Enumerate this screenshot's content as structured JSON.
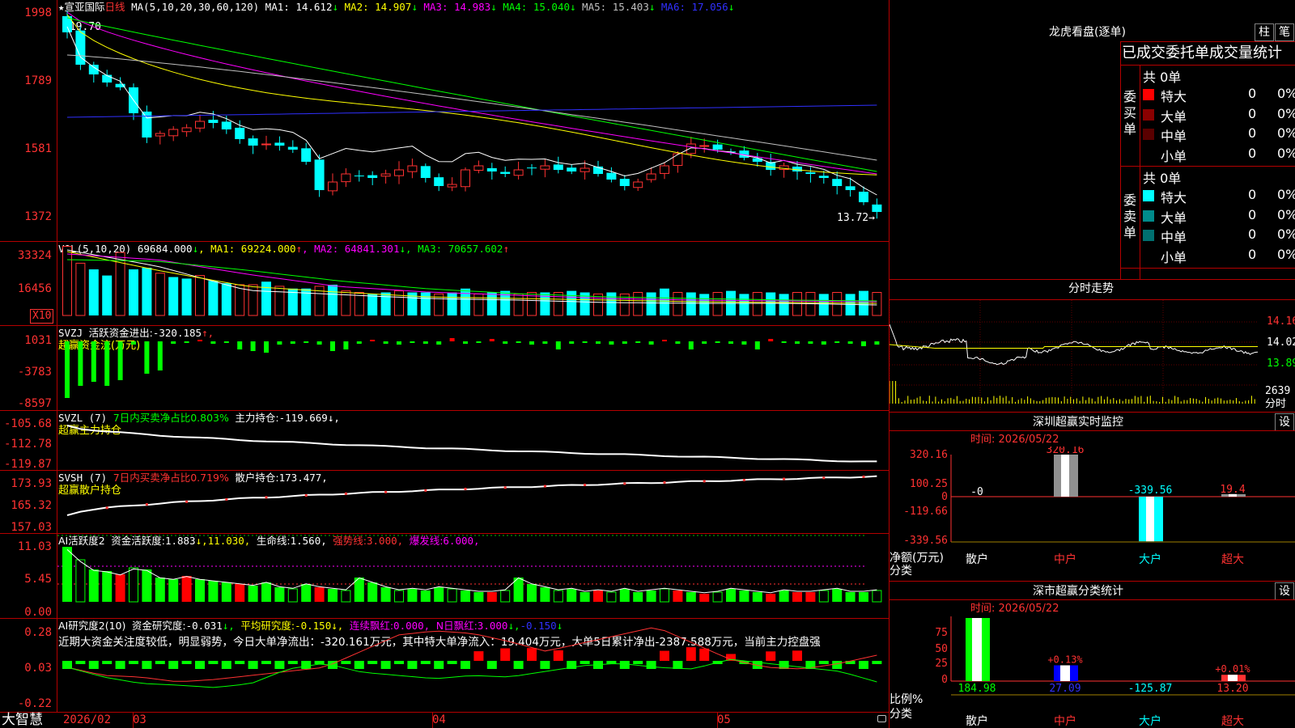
{
  "app": {
    "brand": "大智慧"
  },
  "main_chart": {
    "star": "★",
    "stock_name": "宣亚国际",
    "period": "日线",
    "ma_label": "MA(5,10,20,30,60,120)",
    "ma": [
      {
        "name": "MA1:",
        "value": "14.612",
        "arrow": "↓",
        "color": "#ffffff"
      },
      {
        "name": "MA2:",
        "value": "14.907",
        "arrow": "↓",
        "color": "#ffff00"
      },
      {
        "name": "MA3:",
        "value": "14.983",
        "arrow": "↓",
        "color": "#ff00ff"
      },
      {
        "name": "MA4:",
        "value": "15.040",
        "arrow": "↓",
        "color": "#00ff00"
      },
      {
        "name": "MA5:",
        "value": "15.403",
        "arrow": "↓",
        "color": "#c0c0c0"
      },
      {
        "name": "MA6:",
        "value": "17.056",
        "arrow": "↓",
        "color": "#3030ff"
      }
    ],
    "high_label": "←19.70",
    "low_label": "13.72→",
    "y_ticks": [
      "1998",
      "1789",
      "1581",
      "1372"
    ]
  },
  "vol": {
    "label": "VOL(5,10,20)",
    "value": "69684.000",
    "arrow": "↓",
    "ma": [
      {
        "name": "MA1:",
        "value": "69224.000",
        "arrow": "↑",
        "color": "#ffff00"
      },
      {
        "name": "MA2:",
        "value": "64841.301",
        "arrow": "↓",
        "color": "#ff00ff"
      },
      {
        "name": "MA3:",
        "value": "70657.602",
        "arrow": "↑",
        "color": "#00ff00"
      }
    ],
    "y_ticks": [
      "33324",
      "16456"
    ],
    "unit": "X10"
  },
  "svzj": {
    "label": "SVZJ",
    "desc": "活跃资金进出:",
    "value": "-320.185",
    "arrow": "↑,",
    "sub": "超赢资金流(万元)",
    "y_ticks": [
      "1031",
      "-3783",
      "-8597"
    ]
  },
  "svzl": {
    "label": "SVZL (7)",
    "desc": "7日内买卖净占比0.803%",
    "main_label": "主力持仓:",
    "value": "-119.669",
    "arrow": "↓,",
    "sub": "超赢主力持仓",
    "y_ticks": [
      "-105.68",
      "-112.78",
      "-119.87"
    ]
  },
  "svsh": {
    "label": "SVSH (7)",
    "desc": "7日内买卖净占比0.719%",
    "main_label": "散户持仓:",
    "value": "173.477,",
    "sub": "超赢散户持仓",
    "y_ticks": [
      "173.93",
      "165.32",
      "157.03"
    ]
  },
  "ai_active": {
    "label": "AI活跃度2",
    "desc": "资金活跃度:",
    "value": "1.883",
    "arrow": "↓,",
    "v2": "11.030,",
    "life_label": "生命线:",
    "life_value": "1.560,",
    "strong_label": "强势线:",
    "strong_value": "3.000,",
    "burst_label": "爆发线:",
    "burst_value": "6.000,",
    "y_ticks": [
      "11.03",
      "5.45",
      "0.00"
    ]
  },
  "ai_research": {
    "label": "AI研究度2(10)",
    "desc": "资金研究度:",
    "value": "-0.031",
    "arrow": "↓,",
    "avg_label": "平均研究度:",
    "avg_value": "-0.150",
    "lianxu_label": "连续飘红:",
    "lianxu_value": "0.000,",
    "nday_label": "N日飘红:",
    "nday_value": "3.000",
    "last_value": "-0.150",
    "note": "近期大资金关注度较低，明显弱势，今日大单净流出：-320.161万元，其中特大单净流入：19.404万元，大单5日累计净出-2387.588万元，当前主力控盘强",
    "y_ticks": [
      "0.28",
      "0.03",
      "-0.22"
    ]
  },
  "date_axis": [
    "2026/02",
    "03",
    "04",
    "05"
  ],
  "longhu": {
    "title": "龙虎看盘(逐单)",
    "btn_a": "柱",
    "btn_b": "笔",
    "header": "已成交委托单成交量统计",
    "buy_label": "委买单",
    "sell_label": "委卖单",
    "buy_total": "共 0单",
    "sell_total": "共 0单",
    "buy_rows": [
      {
        "name": "特大",
        "count": "0",
        "pct": "0%",
        "color": "#ff0000"
      },
      {
        "name": "大单",
        "count": "0",
        "pct": "0%",
        "color": "#8b0000"
      },
      {
        "name": "中单",
        "count": "0",
        "pct": "0%",
        "color": "#5a0000"
      },
      {
        "name": "小单",
        "count": "0",
        "pct": "0%",
        "color": "#000000"
      }
    ],
    "sell_rows": [
      {
        "name": "特大",
        "count": "0",
        "pct": "0%",
        "color": "#00ffff"
      },
      {
        "name": "大单",
        "count": "0",
        "pct": "0%",
        "color": "#008b8b"
      },
      {
        "name": "中单",
        "count": "0",
        "pct": "0%",
        "color": "#007070"
      },
      {
        "name": "小单",
        "count": "0",
        "pct": "0%",
        "color": "#000000"
      }
    ]
  },
  "intraday": {
    "title": "分时走势",
    "y_ticks": [
      "14.16",
      "14.02",
      "13.89"
    ],
    "vol_value": "2639",
    "vol_unit": "分时"
  },
  "sz_monitor": {
    "title": "深圳超赢实时监控",
    "btn": "设",
    "time_label": "时间:",
    "time": "2026/05/22",
    "y_ticks": [
      "320.16",
      "100.25",
      "0",
      "-119.66",
      "-339.56"
    ],
    "y_label": "净额(万元)",
    "cat_label": "分类",
    "categories": [
      "散户",
      "中户",
      "大户",
      "超大"
    ],
    "values": [
      "-0",
      "320.16",
      "-339.56",
      "19.4"
    ]
  },
  "sz_stats": {
    "title": "深市超赢分类统计",
    "btn": "设",
    "time_label": "时间:",
    "time": "2026/05/22",
    "y_ticks": [
      "75",
      "50",
      "25",
      "0"
    ],
    "y_label": "比例%",
    "cat_label": "分类",
    "categories": [
      "散户",
      "中户",
      "大户",
      "超大"
    ],
    "pct_labels": [
      "",
      "+0.13%",
      "",
      "+0.01%"
    ],
    "values": [
      "184.98",
      "27.09",
      "-125.87",
      "13.20"
    ]
  }
}
